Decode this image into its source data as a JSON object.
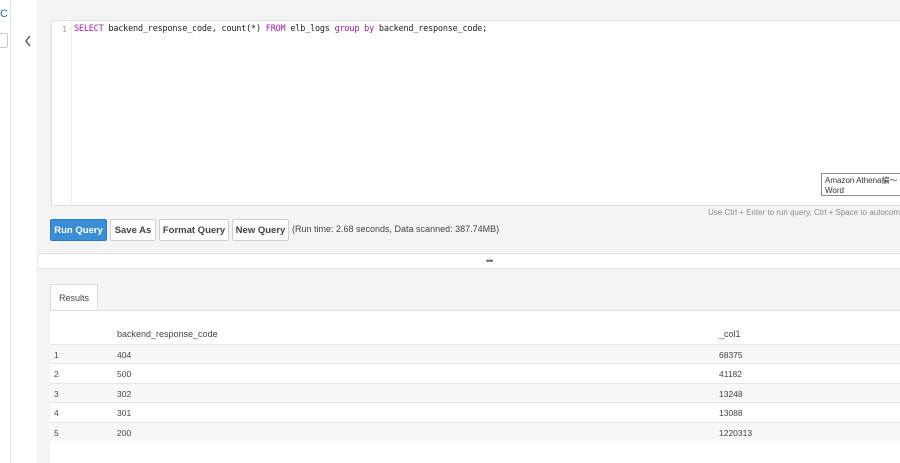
{
  "left_strip": {
    "symbol": "C"
  },
  "editor": {
    "line_number": "1",
    "tokens": {
      "select": "SELECT",
      "cols": " backend_response_code, count(*) ",
      "from": "FROM",
      "table": " elb_logs ",
      "group_by": "group by",
      "tail": " backend_response_code;"
    }
  },
  "tooltip": {
    "line1": "Amazon Athena編〜",
    "line2": "Word"
  },
  "hint": "Use Ctrl + Enter to run query, Ctrl + Space to autocom",
  "buttons": {
    "run_query": "Run Query",
    "save_as": "Save As",
    "format_query": "Format Query",
    "new_query": "New Query"
  },
  "runtime": "(Run time: 2.68 seconds, Data scanned: 387.74MB)",
  "splitter": "•••",
  "results": {
    "tab_label": "Results",
    "columns": [
      "backend_response_code",
      "_col1"
    ],
    "rows": [
      {
        "index": "1",
        "code": "404",
        "count": "68375"
      },
      {
        "index": "2",
        "code": "500",
        "count": "41182"
      },
      {
        "index": "3",
        "code": "302",
        "count": "13248"
      },
      {
        "index": "4",
        "code": "301",
        "count": "13088"
      },
      {
        "index": "5",
        "code": "200",
        "count": "1220313"
      }
    ]
  }
}
